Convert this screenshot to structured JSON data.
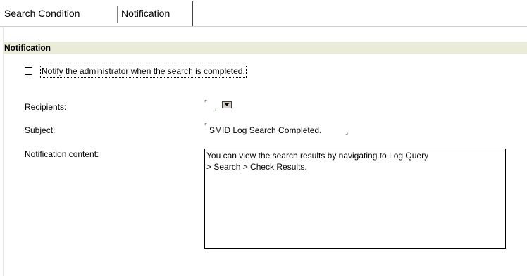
{
  "tabs": [
    {
      "label": "Search Condition",
      "active": false
    },
    {
      "label": "Notification",
      "active": true
    }
  ],
  "section": {
    "title": "Notification"
  },
  "notify": {
    "checked": false,
    "label": "Notify the administrator when the search is completed."
  },
  "fields": {
    "recipients_label": "Recipients:",
    "recipients_value": "",
    "subject_label": "Subject:",
    "subject_value": "SMID Log Search Completed.",
    "content_label": "Notification content:",
    "content_value": "You can view the search results by navigating to Log Query\n> Search > Check Results."
  },
  "icons": {
    "dropdown": "chevron-down-icon",
    "field_open_mark": "bracket-open-icon",
    "field_close_mark": "bracket-close-icon"
  }
}
